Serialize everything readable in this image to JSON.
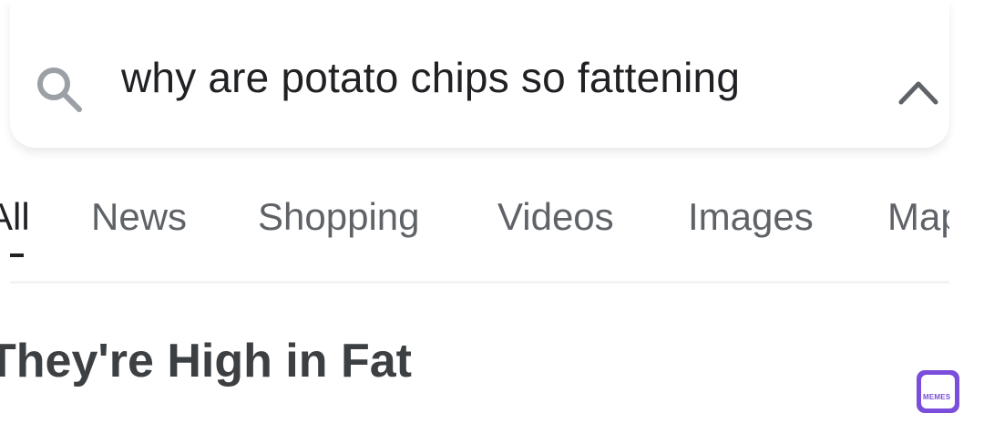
{
  "search": {
    "query": "why are potato chips so fattening",
    "search_icon": "search-icon",
    "collapse_icon": "chevron-up-icon"
  },
  "tabs": [
    {
      "label": "All",
      "active": true
    },
    {
      "label": "News"
    },
    {
      "label": "Shopping"
    },
    {
      "label": "Videos"
    },
    {
      "label": "Images"
    },
    {
      "label": "Maps"
    }
  ],
  "answer": {
    "title": "They're High in Fat"
  },
  "watermark": {
    "text": "MEMES",
    "color": "#7b4ddb"
  },
  "colors": {
    "text_primary": "#202124",
    "text_secondary": "#5f6368",
    "heading": "#3c4043"
  }
}
